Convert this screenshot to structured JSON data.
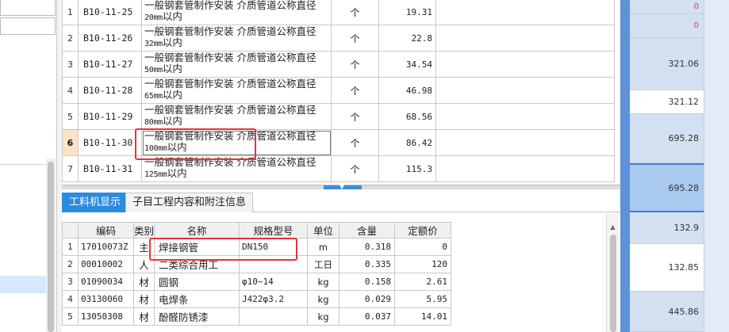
{
  "quota_list": {
    "rows": [
      {
        "index": "1",
        "code": "B10-11-25",
        "name_text": "一般钢套管制作安装 介质管道公称直径",
        "name_size": "20mm",
        "name_tail": "以内",
        "unit": "个",
        "quantity": "19.31"
      },
      {
        "index": "2",
        "code": "B10-11-26",
        "name_text": "一般钢套管制作安装 介质管道公称直径",
        "name_size": "32mm",
        "name_tail": "以内",
        "unit": "个",
        "quantity": "22.8"
      },
      {
        "index": "3",
        "code": "B10-11-27",
        "name_text": "一般钢套管制作安装 介质管道公称直径",
        "name_size": "50mm",
        "name_tail": "以内",
        "unit": "个",
        "quantity": "34.54"
      },
      {
        "index": "4",
        "code": "B10-11-28",
        "name_text": "一般钢套管制作安装 介质管道公称直径",
        "name_size": "65mm",
        "name_tail": "以内",
        "unit": "个",
        "quantity": "46.98"
      },
      {
        "index": "5",
        "code": "B10-11-29",
        "name_text": "一般钢套管制作安装 介质管道公称直径",
        "name_size": "80mm",
        "name_tail": "以内",
        "unit": "个",
        "quantity": "68.56"
      },
      {
        "index": "6",
        "code": "B10-11-30",
        "name_text": "一般钢套管制作安装 介质管道公称直径",
        "name_size": "100mm",
        "name_tail": "以内",
        "unit": "个",
        "quantity": "86.42"
      },
      {
        "index": "7",
        "code": "B10-11-31",
        "name_text": "一般钢套管制作安装 介质管道公称直径",
        "name_size": "125mm",
        "name_tail": "以内",
        "unit": "个",
        "quantity": "115.3"
      }
    ],
    "selected_index": "6"
  },
  "tabs": [
    {
      "label": "工料机显示",
      "active": true
    },
    {
      "label": "子目工程内容和附注信息",
      "active": false
    }
  ],
  "resource_table": {
    "headers": {
      "index": "",
      "code": "编码",
      "category": "类别",
      "name": "名称",
      "spec": "规格型号",
      "unit": "单位",
      "content": "含量",
      "price": "定额价"
    },
    "rows": [
      {
        "index": "1",
        "code": "17010073Z",
        "category": "主",
        "name": "焊接钢管",
        "spec": "DN150",
        "unit": "m",
        "content": "0.318",
        "price": "0"
      },
      {
        "index": "2",
        "code": "00010002",
        "category": "人",
        "name": "二类综合用工",
        "spec": "",
        "unit": "工日",
        "content": "0.335",
        "price": "120"
      },
      {
        "index": "3",
        "code": "01090034",
        "category": "材",
        "name": "圆钢",
        "spec": "φ10~14",
        "unit": "kg",
        "content": "0.158",
        "price": "2.61"
      },
      {
        "index": "4",
        "code": "03130060",
        "category": "材",
        "name": "电焊条",
        "spec": "J422φ3.2",
        "unit": "kg",
        "content": "0.029",
        "price": "5.95"
      },
      {
        "index": "5",
        "code": "13050308",
        "category": "材",
        "name": "酚醛防锈漆",
        "spec": "",
        "unit": "kg",
        "content": "0.037",
        "price": "14.01"
      }
    ]
  },
  "right_values": [
    "0",
    "0",
    "321.06",
    "321.12",
    "695.28",
    "695.28",
    "132.9",
    "132.85",
    "445.86"
  ],
  "colors": {
    "accent_blue": "#2b8be0",
    "highlight_red": "#e8333b",
    "selected_row_bg": "#fbe4c4",
    "strip_bg": "#d2e0f2"
  }
}
